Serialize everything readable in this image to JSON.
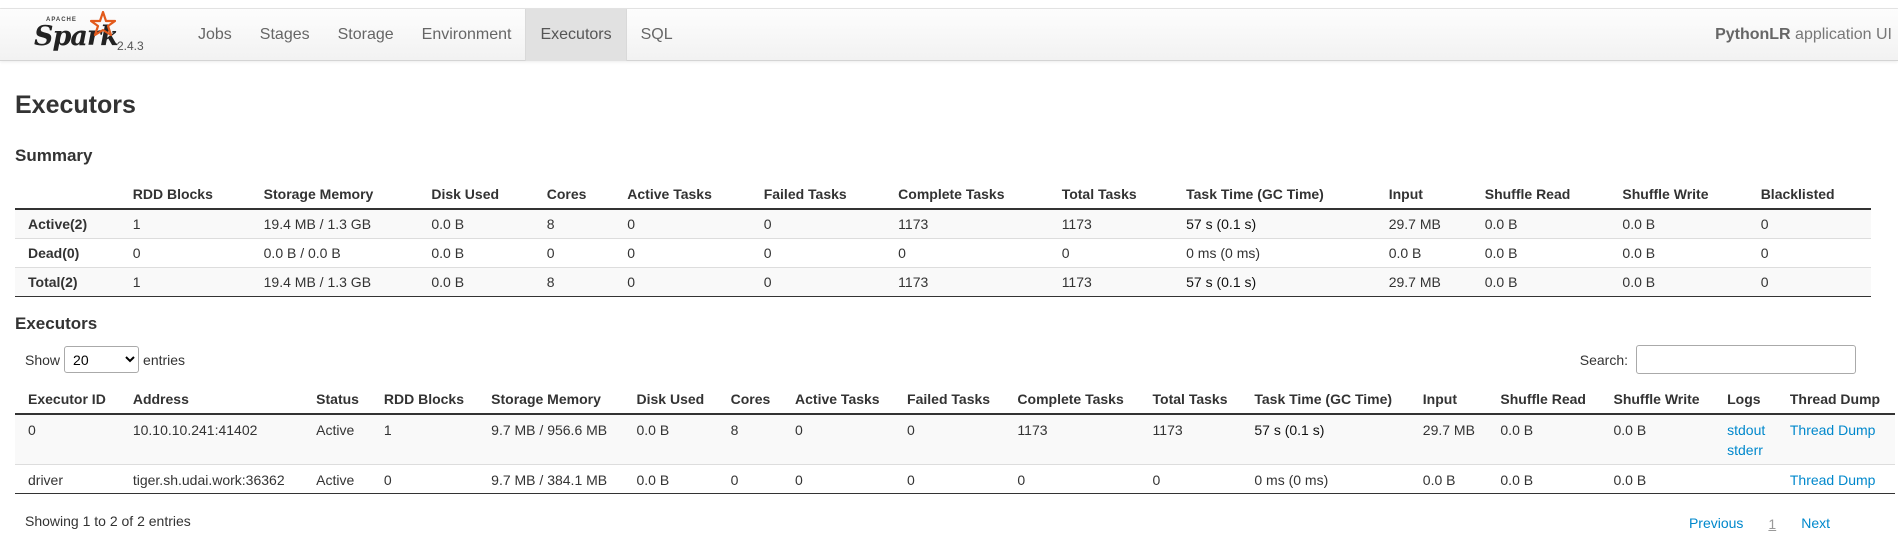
{
  "header": {
    "apache": "APACHE",
    "brand": "Spark",
    "version": "2.4.3",
    "nav": [
      "Jobs",
      "Stages",
      "Storage",
      "Environment",
      "Executors",
      "SQL"
    ],
    "active_tab": "Executors",
    "app_name_bold": "PythonLR",
    "app_name_rest": " application UI"
  },
  "page_title": "Executors",
  "summary": {
    "title": "Summary",
    "columns": [
      "",
      "RDD Blocks",
      "Storage Memory",
      "Disk Used",
      "Cores",
      "Active Tasks",
      "Failed Tasks",
      "Complete Tasks",
      "Total Tasks",
      "Task Time (GC Time)",
      "Input",
      "Shuffle Read",
      "Shuffle Write",
      "Blacklisted"
    ],
    "rows": [
      [
        "Active(2)",
        "1",
        "19.4 MB / 1.3 GB",
        "0.0 B",
        "8",
        "0",
        "0",
        "1173",
        "1173",
        "57 s (0.1 s)",
        "29.7 MB",
        "0.0 B",
        "0.0 B",
        "0"
      ],
      [
        "Dead(0)",
        "0",
        "0.0 B / 0.0 B",
        "0.0 B",
        "0",
        "0",
        "0",
        "0",
        "0",
        "0 ms (0 ms)",
        "0.0 B",
        "0.0 B",
        "0.0 B",
        "0"
      ],
      [
        "Total(2)",
        "1",
        "19.4 MB / 1.3 GB",
        "0.0 B",
        "8",
        "0",
        "0",
        "1173",
        "1173",
        "57 s (0.1 s)",
        "29.7 MB",
        "0.0 B",
        "0.0 B",
        "0"
      ]
    ]
  },
  "executors": {
    "title": "Executors",
    "show_label": "Show",
    "page_size": "20",
    "entries_label": "entries",
    "search_label": "Search:",
    "search_value": "",
    "columns": [
      "Executor ID",
      "Address",
      "Status",
      "RDD Blocks",
      "Storage Memory",
      "Disk Used",
      "Cores",
      "Active Tasks",
      "Failed Tasks",
      "Complete Tasks",
      "Total Tasks",
      "Task Time (GC Time)",
      "Input",
      "Shuffle Read",
      "Shuffle Write",
      "Logs",
      "Thread Dump"
    ],
    "rows": [
      [
        "0",
        "10.10.10.241:41402",
        "Active",
        "1",
        "9.7 MB / 956.6 MB",
        "0.0 B",
        "8",
        "0",
        "0",
        "1173",
        "1173",
        "57 s (0.1 s)",
        "29.7 MB",
        "0.0 B",
        "0.0 B"
      ],
      [
        "driver",
        "tiger.sh.udai.work:36362",
        "Active",
        "0",
        "9.7 MB / 384.1 MB",
        "0.0 B",
        "0",
        "0",
        "0",
        "0",
        "0",
        "0 ms (0 ms)",
        "0.0 B",
        "0.0 B",
        "0.0 B"
      ]
    ],
    "logs": {
      "stdout": "stdout",
      "stderr": "stderr"
    },
    "thread_dump": "Thread Dump",
    "showing": "Showing 1 to 2 of 2 entries",
    "pager": {
      "previous": "Previous",
      "current": "1",
      "next": "Next"
    }
  },
  "colors": {
    "link": "#0088cc",
    "active_tab_bg": "#e1e1e1"
  }
}
